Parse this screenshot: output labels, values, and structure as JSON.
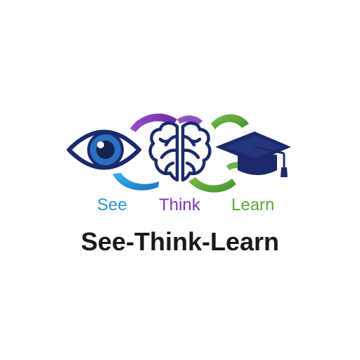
{
  "logo": {
    "icons": [
      "eye-icon",
      "brain-icon",
      "graduation-cap-icon"
    ],
    "words": {
      "see": "See",
      "think": "Think",
      "learn": "Learn"
    },
    "wordmark": "See-Think-Learn",
    "colors": {
      "navy": "#1c2a6b",
      "blue": "#2a93d5",
      "purple": "#7d33b5",
      "green": "#5aaa3a",
      "text": "#1a1a1a"
    }
  }
}
